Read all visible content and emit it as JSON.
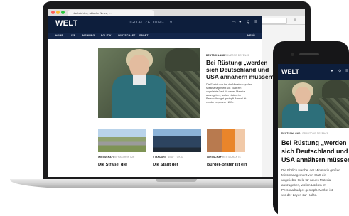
{
  "browser": {
    "tab_title": "Nachrichten, aktuelle News, …",
    "url": "www.welt.de"
  },
  "site": {
    "logo": "WELT",
    "topnav": [
      "DIGITAL",
      "ZEITUNG",
      "TV"
    ],
    "subnav": [
      "HOME",
      "LIVE",
      "MEINUNG",
      "POLITIK",
      "WIRTSCHAFT",
      "SPORT",
      "MENÜ"
    ]
  },
  "lead_article": {
    "tag": "DEUTSCHLAND",
    "tag_secondary": "GRAUZONE DEFENCE",
    "headline_lines": [
      "Bei Rüstung „werden",
      "sich Deutschland und",
      "USA annähern müssen“"
    ],
    "body_lines": [
      "Die Ehrlich war bei der Ministerin großen",
      "Missmanagement vor. Statt ein",
      "ungeliebte Geld für neues Material",
      "auszugeben, wollen Lücken im",
      "Personalbudget gestopft. Merkel ist",
      "vor der Leyen zur Hälfte."
    ]
  },
  "cards": [
    {
      "tag": "WIRTSCHAFT",
      "tag_secondary": "INFRASTRUKTUR",
      "title": "Die Straße, die"
    },
    {
      "tag": "STANDORT",
      "tag_secondary": "NEU · TOKIO",
      "title": "Die Stadt der"
    },
    {
      "tag": "WIRTSCHAFT",
      "tag_secondary": "RESTAURANTS",
      "title": "Burger-Brater ist ein"
    }
  ],
  "phone": {
    "logo": "WELT",
    "tag": "DEUTSCHLAND",
    "tag_secondary": "GRAUZONE DEFENCE",
    "headline_lines": [
      "Bei Rüstung „werden",
      "sich Deutschland und",
      "USA annähern müssen“"
    ],
    "body_lines": [
      "Die Ehrlich war bei der Ministerin großen",
      "Missmanagement vor. Statt ein",
      "ungeliebte Geld für neues Material",
      "auszugeben, wollen Lücken im",
      "Personalbudget gestopft. Merkel ist",
      "vor der Leyen zur Hälfte."
    ]
  },
  "icons": {
    "traffic_lights": [
      "#ff5f57",
      "#ffbd2e",
      "#28c840"
    ],
    "search": "search-icon",
    "user": "user-icon",
    "menu": "menu-icon"
  },
  "colors": {
    "brand_navy": "#0d1e3c"
  }
}
